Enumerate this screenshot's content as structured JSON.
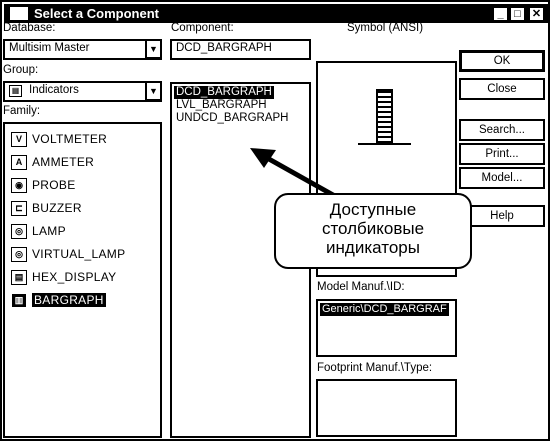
{
  "window": {
    "title": "Select a Component",
    "minimize_label": "_",
    "maximize_label": "□",
    "close_label": "✕"
  },
  "database": {
    "label": "Database:",
    "value": "Multisim Master"
  },
  "group": {
    "label": "Group:",
    "value": "Indicators"
  },
  "family": {
    "label": "Family:",
    "items": [
      {
        "label": "VOLTMETER",
        "icon": "V",
        "selected": false
      },
      {
        "label": "AMMETER",
        "icon": "A",
        "selected": false
      },
      {
        "label": "PROBE",
        "icon": "◉",
        "selected": false
      },
      {
        "label": "BUZZER",
        "icon": "⊏",
        "selected": false
      },
      {
        "label": "LAMP",
        "icon": "◎",
        "selected": false
      },
      {
        "label": "VIRTUAL_LAMP",
        "icon": "◎",
        "selected": false
      },
      {
        "label": "HEX_DISPLAY",
        "icon": "▤",
        "selected": false
      },
      {
        "label": "BARGRAPH",
        "icon": "▥",
        "selected": true
      }
    ]
  },
  "component": {
    "label": "Component:",
    "value": "DCD_BARGRAPH",
    "items": [
      {
        "label": "DCD_BARGRAPH",
        "selected": true
      },
      {
        "label": "LVL_BARGRAPH",
        "selected": false
      },
      {
        "label": "UNDCD_BARGRAPH",
        "selected": false
      }
    ]
  },
  "symbol": {
    "label": "Symbol (ANSI)"
  },
  "model": {
    "label": "Model Manuf.\\ID:",
    "value": "Generic\\DCD_BARGRAF"
  },
  "footprint": {
    "label": "Footprint Manuf.\\Type:"
  },
  "buttons": {
    "ok": "OK",
    "close": "Close",
    "search": "Search...",
    "print": "Print...",
    "model": "Model...",
    "help": "Help"
  },
  "callout": {
    "line1": "Доступные",
    "line2": "столбиковые",
    "line3": "индикаторы"
  }
}
